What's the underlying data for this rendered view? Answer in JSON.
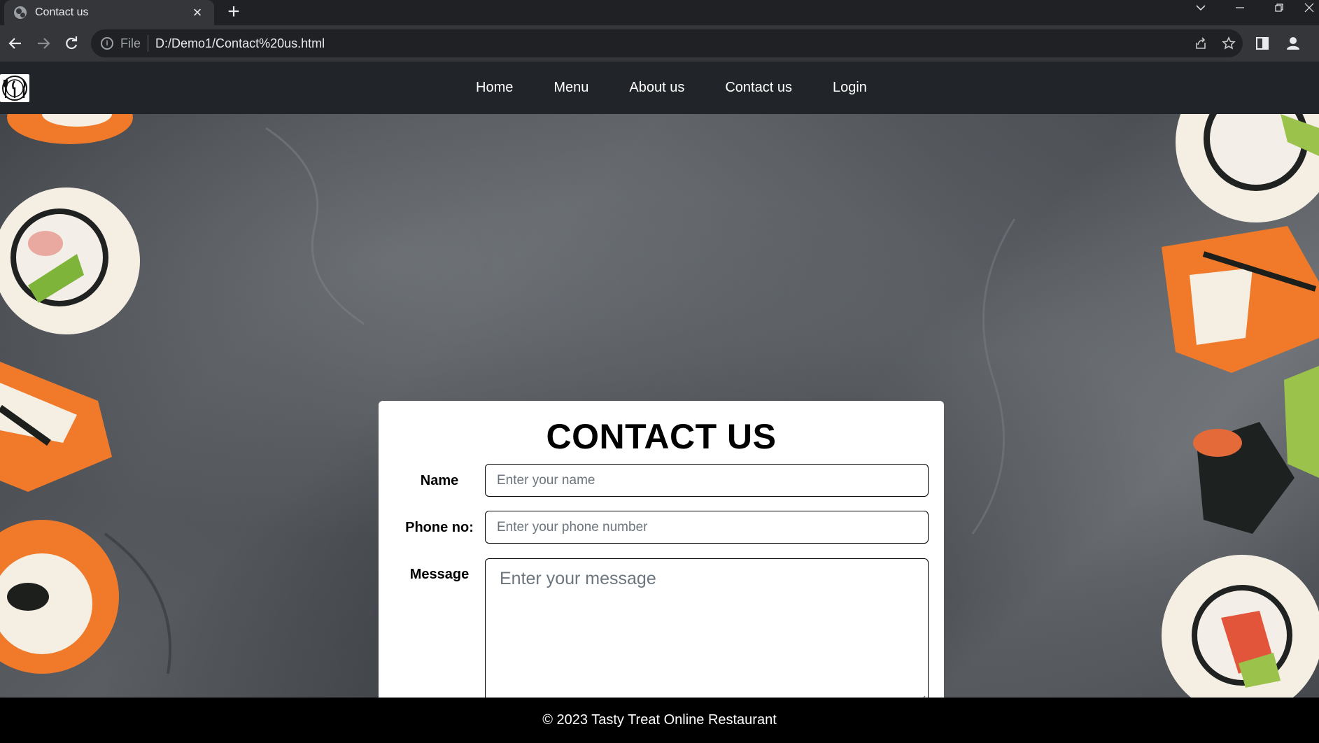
{
  "browser": {
    "tab_title": "Contact us",
    "tab_close": "×",
    "new_tab": "+",
    "address_scheme": "File",
    "address_url": "D:/Demo1/Contact%20us.html",
    "icons": [
      "globe-icon",
      "close-icon",
      "plus-icon",
      "chevron-down-icon",
      "minimize-icon",
      "restore-icon",
      "back-arrow-icon",
      "forward-arrow-icon",
      "reload-icon",
      "info-icon",
      "share-icon",
      "star-icon",
      "side-panel-icon",
      "profile-icon"
    ]
  },
  "site": {
    "logo_icon": "cutlery-icon",
    "nav": {
      "items": [
        {
          "label": "Home"
        },
        {
          "label": "Menu"
        },
        {
          "label": "About us"
        },
        {
          "label": "Contact us"
        },
        {
          "label": "Login"
        }
      ]
    }
  },
  "contact": {
    "title": "CONTACT US",
    "name_label": "Name",
    "name_placeholder": "Enter your name",
    "phone_label": "Phone no:",
    "phone_placeholder": "Enter your phone number",
    "message_label": "Message",
    "message_placeholder": "Enter your message"
  },
  "footer": {
    "text": "© 2023 Tasty Treat Online Restaurant"
  },
  "colors": {
    "nav_bg": "#212529",
    "footer_bg": "#000000",
    "card_bg": "#ffffff",
    "background_stone": "#4b4f54",
    "sushi_orange": "#f07a2a"
  }
}
